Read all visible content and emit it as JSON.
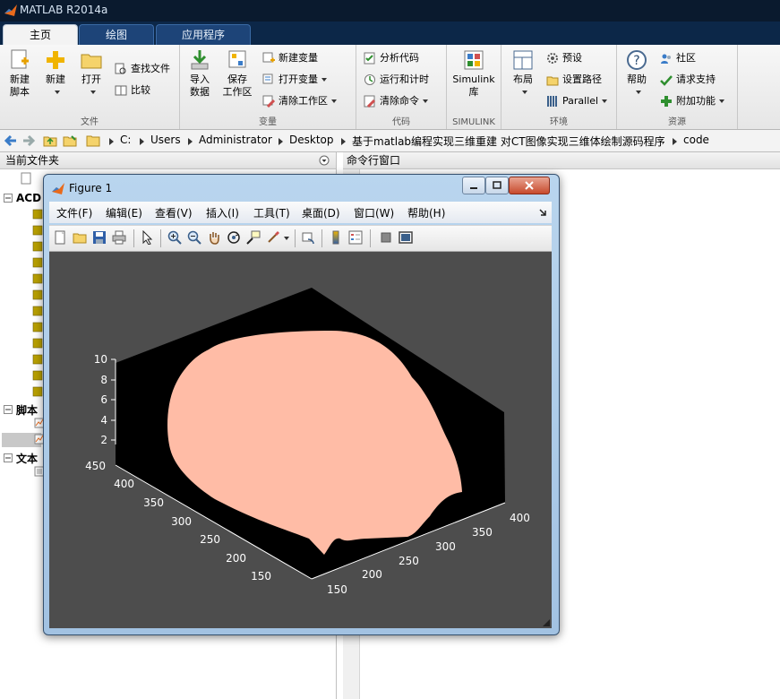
{
  "app": {
    "title": "MATLAB R2014a"
  },
  "tabs": [
    "主页",
    "绘图",
    "应用程序"
  ],
  "ribbon": {
    "file_group": {
      "label": "文件",
      "new_script": "新建\n脚本",
      "new": "新建",
      "open": "打开",
      "find_files": "查找文件",
      "compare": "比较"
    },
    "variable_group": {
      "label": "变量",
      "import": "导入\n数据",
      "save_ws": "保存\n工作区",
      "new_var": "新建变量",
      "open_var": "打开变量",
      "clear_ws": "清除工作区"
    },
    "code_group": {
      "label": "代码",
      "analyze": "分析代码",
      "run_time": "运行和计时",
      "clear_cmd": "清除命令"
    },
    "simulink_group": {
      "label": "SIMULINK",
      "simulink_lib": "Simulink\n库"
    },
    "env_group": {
      "label": "环境",
      "layout": "布局",
      "prefs": "预设",
      "set_path": "设置路径",
      "parallel": "Parallel"
    },
    "res_group": {
      "label": "资源",
      "help": "帮助",
      "community": "社区",
      "support": "请求支持",
      "addons": "附加功能"
    }
  },
  "address": {
    "crumbs": [
      "C:",
      "Users",
      "Administrator",
      "Desktop",
      "基于matlab编程实现三维重建 对CT图像实现三维体绘制源码程序",
      "code"
    ]
  },
  "left_panel": {
    "title": "当前文件夹",
    "items": [
      "ACD",
      "脚本",
      "文本"
    ]
  },
  "right_panel": {
    "title": "命令行窗口"
  },
  "figure": {
    "title": "Figure 1",
    "menu": [
      "文件(F)",
      "编辑(E)",
      "查看(V)",
      "插入(I)",
      "工具(T)",
      "桌面(D)",
      "窗口(W)",
      "帮助(H)"
    ],
    "axes": {
      "z_ticks": [
        "2",
        "4",
        "6",
        "8",
        "10"
      ],
      "y_ticks": [
        "150",
        "200",
        "250",
        "300",
        "350",
        "400",
        "450"
      ],
      "x_ticks": [
        "150",
        "200",
        "250",
        "300",
        "350",
        "400"
      ]
    },
    "colors": {
      "background": "#4d4d4d",
      "box": "#000000",
      "surface": "#ffbca6"
    }
  }
}
